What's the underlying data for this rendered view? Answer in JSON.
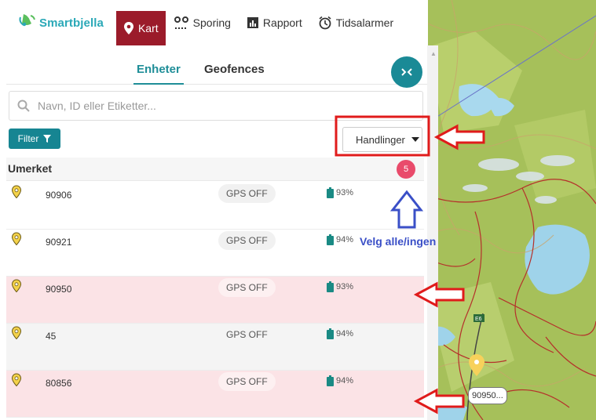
{
  "nav": {
    "brand": "Smartbjella",
    "items": [
      {
        "label": "Kart",
        "icon": "map-pin-icon",
        "active": true
      },
      {
        "label": "Sporing",
        "icon": "tracking-icon"
      },
      {
        "label": "Rapport",
        "icon": "report-icon"
      },
      {
        "label": "Tidsalarmer",
        "icon": "alarm-clock-icon"
      }
    ]
  },
  "panel": {
    "tabs": [
      {
        "label": "Enheter",
        "active": true
      },
      {
        "label": "Geofences"
      }
    ],
    "collapse_label": ">‹",
    "search_placeholder": "Navn, ID eller Etiketter...",
    "filter_label": "Filter",
    "actions_label": "Handlinger",
    "group": {
      "label": "Umerket",
      "count": "5"
    },
    "devices": [
      {
        "id": "90906",
        "gps": "GPS OFF",
        "battery": "93%",
        "state": "normal"
      },
      {
        "id": "90921",
        "gps": "GPS OFF",
        "battery": "94%",
        "state": "normal"
      },
      {
        "id": "90950",
        "gps": "GPS OFF",
        "battery": "93%",
        "state": "selected"
      },
      {
        "id": "45",
        "gps": "GPS OFF",
        "battery": "94%",
        "state": "plain"
      },
      {
        "id": "80856",
        "gps": "GPS OFF",
        "battery": "94%",
        "state": "selected"
      }
    ]
  },
  "map": {
    "marker_label": "90950...",
    "road_label": "E6"
  },
  "annotation": {
    "select_all_text": "Velg alle/ingen"
  },
  "colors": {
    "brand": "#2aa8b7",
    "nav_active": "#9b1b2a",
    "teal": "#168592",
    "badge": "#e94b6b",
    "selected_row": "#fbe3e6",
    "annotation_red": "#e01b1b",
    "annotation_blue": "#3a4fc7"
  }
}
